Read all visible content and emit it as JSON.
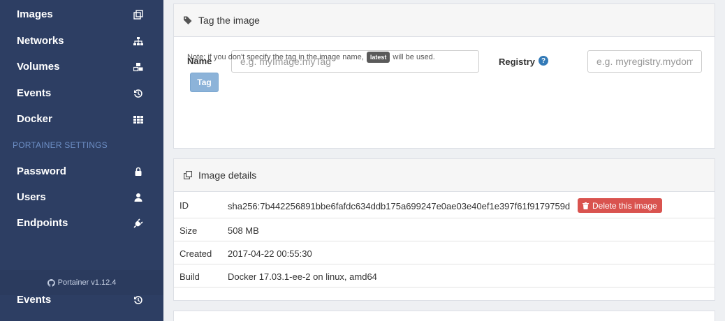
{
  "sidebar": {
    "items": [
      {
        "label": "Images",
        "icon": "clone-icon"
      },
      {
        "label": "Networks",
        "icon": "sitemap-icon"
      },
      {
        "label": "Volumes",
        "icon": "cubes-icon"
      },
      {
        "label": "Events",
        "icon": "history-icon"
      },
      {
        "label": "Docker",
        "icon": "th-icon"
      }
    ],
    "section_title": "PORTAINER SETTINGS",
    "settings_items": [
      {
        "label": "Password",
        "icon": "lock-icon"
      },
      {
        "label": "Users",
        "icon": "user-icon"
      },
      {
        "label": "Endpoints",
        "icon": "plug-icon"
      }
    ],
    "footer_text": "Portainer v1.12.4",
    "trailing_item": {
      "label": "Events",
      "icon": "history-icon"
    }
  },
  "tag_panel": {
    "title": "Tag the image",
    "name_label": "Name",
    "name_placeholder": "e.g. myImage:myTag",
    "registry_label": "Registry",
    "registry_placeholder": "e.g. myregistry.mydomain",
    "help_glyph": "?",
    "note_before": "Note: if you don't specify the tag in the image name,",
    "note_badge": "latest",
    "note_after": "will be used.",
    "tag_button": "Tag"
  },
  "details_panel": {
    "title": "Image details",
    "rows": {
      "id": {
        "key": "ID",
        "value": "sha256:7b442256891bbe6fafdc634ddb175a699247e0ae03e40ef1e397f61f9179759d"
      },
      "size": {
        "key": "Size",
        "value": "508 MB"
      },
      "created": {
        "key": "Created",
        "value": "2017-04-22 00:55:30"
      },
      "build": {
        "key": "Build",
        "value": "Docker 17.03.1-ee-2 on linux, amd64"
      }
    },
    "delete_button": "Delete this image"
  },
  "colors": {
    "sidebar_bg": "#2d3e63",
    "section_title": "#6d8fc6",
    "primary_button": "#8cb3d9",
    "danger_button": "#d9534f"
  }
}
